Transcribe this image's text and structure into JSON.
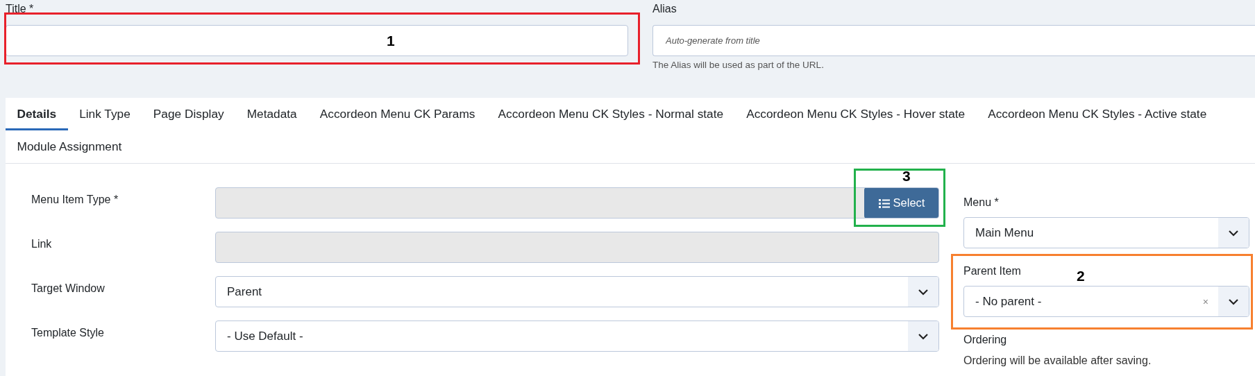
{
  "title_field": {
    "label": "Title *"
  },
  "alias_field": {
    "label": "Alias",
    "placeholder": "Auto-generate from title",
    "hint": "The Alias will be used as part of the URL."
  },
  "tabs": [
    {
      "label": "Details",
      "selected": true
    },
    {
      "label": "Link Type",
      "selected": false
    },
    {
      "label": "Page Display",
      "selected": false
    },
    {
      "label": "Metadata",
      "selected": false
    },
    {
      "label": "Accordeon Menu CK Params",
      "selected": false
    },
    {
      "label": "Accordeon Menu CK Styles - Normal state",
      "selected": false
    },
    {
      "label": "Accordeon Menu CK Styles - Hover state",
      "selected": false
    },
    {
      "label": "Accordeon Menu CK Styles - Active state",
      "selected": false
    },
    {
      "label": "Module Assignment",
      "selected": false
    }
  ],
  "details": [
    {
      "label": "Menu Item Type *",
      "kind": "readonly",
      "button": "Select"
    },
    {
      "label": "Link",
      "kind": "readonly"
    },
    {
      "label": "Target Window",
      "kind": "select",
      "value": "Parent"
    },
    {
      "label": "Template Style",
      "kind": "select",
      "value": "- Use Default -"
    }
  ],
  "side": [
    {
      "label": "Menu *",
      "kind": "select",
      "value": "Main Menu"
    },
    {
      "label": "Parent Item",
      "kind": "select",
      "value": "- No parent -",
      "clear": "×"
    },
    {
      "label": "Ordering",
      "kind": "note",
      "text": "Ordering will be available after saving."
    }
  ],
  "annotations": [
    {
      "number": "1",
      "color": "#e8212b"
    },
    {
      "number": "2",
      "color": "#f7802f"
    },
    {
      "number": "3",
      "color": "#22b14c"
    }
  ]
}
